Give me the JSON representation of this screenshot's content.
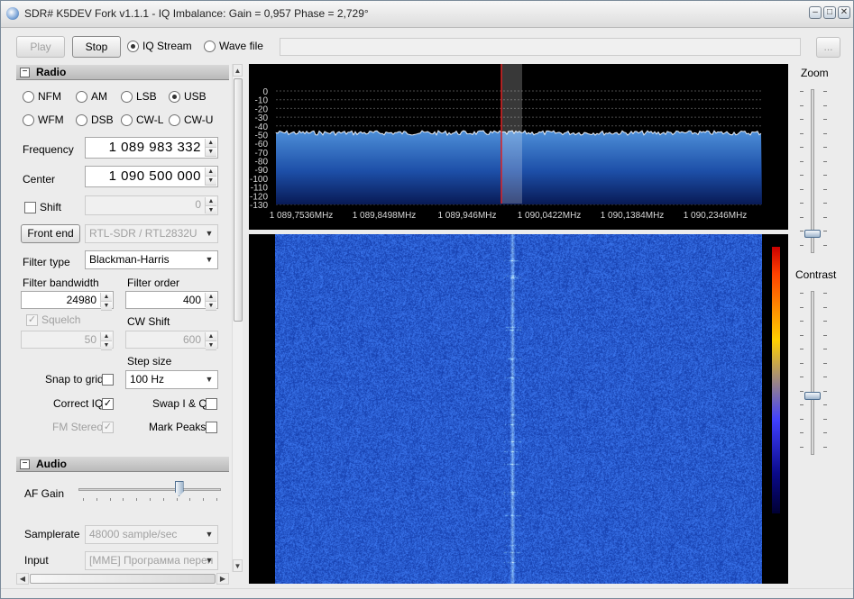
{
  "window": {
    "title": "SDR# K5DEV Fork v1.1.1 - IQ Imbalance: Gain = 0,957 Phase = 2,729°",
    "controls": [
      "minimize",
      "maximize",
      "close"
    ]
  },
  "toolbar": {
    "play_label": "Play",
    "stop_label": "Stop",
    "iq_stream_label": "IQ Stream",
    "wave_file_label": "Wave file",
    "selected_source": "IQ Stream",
    "browse_label": "...",
    "file_path": ""
  },
  "radio": {
    "header": "Radio",
    "modes": [
      {
        "label": "NFM",
        "selected": false
      },
      {
        "label": "AM",
        "selected": false
      },
      {
        "label": "LSB",
        "selected": false
      },
      {
        "label": "USB",
        "selected": true
      },
      {
        "label": "WFM",
        "selected": false
      },
      {
        "label": "DSB",
        "selected": false
      },
      {
        "label": "CW-L",
        "selected": false
      },
      {
        "label": "CW-U",
        "selected": false
      }
    ],
    "frequency_label": "Frequency",
    "frequency_value": "1 089 983 332",
    "center_label": "Center",
    "center_value": "1 090 500 000",
    "shift_label": "Shift",
    "shift_value": "0",
    "front_end_label": "Front end",
    "front_end_value": "RTL-SDR / RTL2832U",
    "filter_type_label": "Filter type",
    "filter_type_value": "Blackman-Harris",
    "filter_bandwidth_label": "Filter bandwidth",
    "filter_bandwidth_value": "24980",
    "filter_order_label": "Filter order",
    "filter_order_value": "400",
    "squelch_label": "Squelch",
    "squelch_value": "50",
    "cw_shift_label": "CW Shift",
    "cw_shift_value": "600",
    "step_size_label": "Step size",
    "step_size_value": "100 Hz",
    "snap_to_grid_label": "Snap to grid",
    "snap_to_grid": false,
    "correct_iq_label": "Correct IQ",
    "correct_iq": true,
    "swap_iq_label": "Swap I & Q",
    "swap_iq": false,
    "fm_stereo_label": "FM Stereo",
    "fm_stereo": true,
    "mark_peaks_label": "Mark Peaks",
    "mark_peaks": false
  },
  "audio": {
    "header": "Audio",
    "af_gain_label": "AF Gain",
    "af_gain_level": 0.72,
    "samplerate_label": "Samplerate",
    "samplerate_value": "48000 sample/sec",
    "input_label": "Input",
    "input_value": "[MME] Программа перен"
  },
  "spectrum": {
    "db_ticks": [
      "0",
      "-10",
      "-20",
      "-30",
      "-40",
      "-50",
      "-60",
      "-70",
      "-80",
      "-90",
      "-100",
      "-110",
      "-120",
      "-130"
    ],
    "freq_ticks": [
      "1 089,7536MHz",
      "1 089,8498MHz",
      "1 089,946MHz",
      "1 090,0422MHz",
      "1 090,1384MHz",
      "1 090,2346MHz"
    ],
    "noise_floor_db": -48,
    "db_range": [
      -130,
      0
    ]
  },
  "sliders": {
    "zoom_label": "Zoom",
    "zoom_level": 0.1,
    "contrast_label": "Contrast",
    "contrast_level": 0.35
  },
  "colors": {
    "spectrum_fill_top": "#3a78c8",
    "spectrum_fill_bottom": "#0a1a55",
    "waterfall_blue": "#1a44c4",
    "tuning_line": "#e02020"
  }
}
